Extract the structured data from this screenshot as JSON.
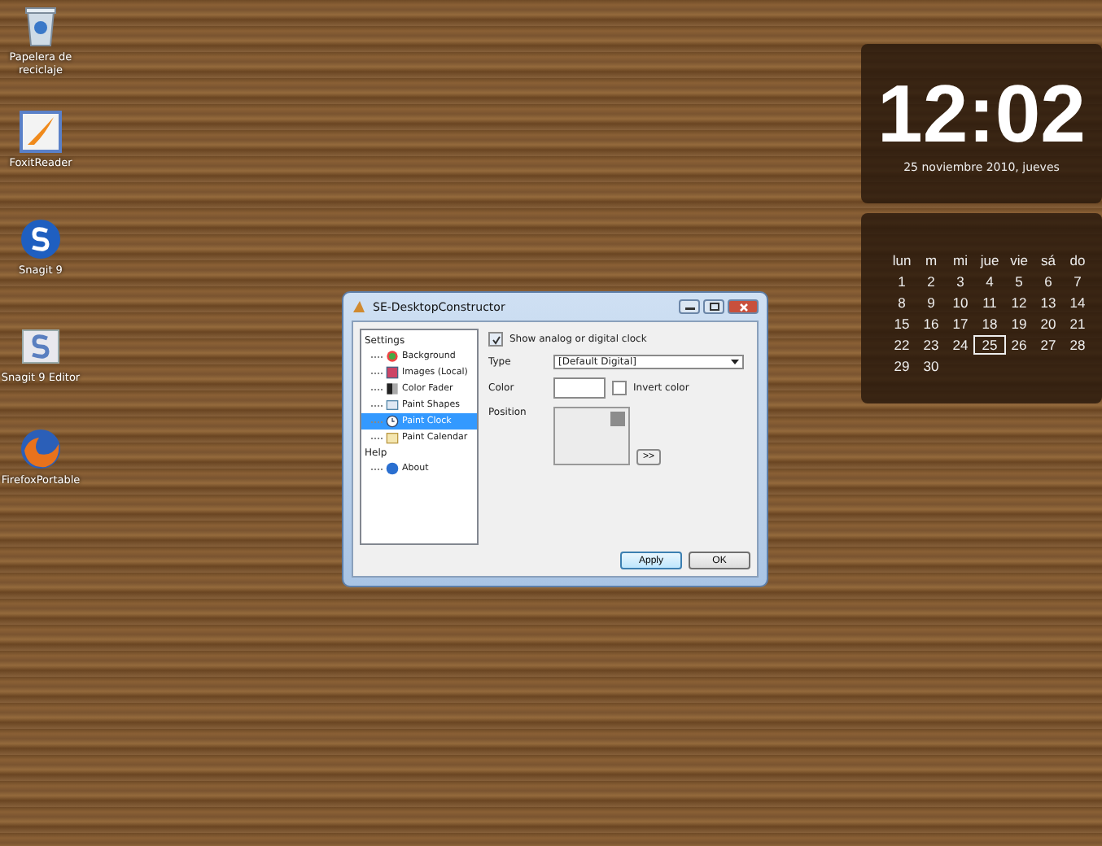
{
  "desktop_icons": [
    {
      "label": "Papelera de reciclaje",
      "kind": "bin"
    },
    {
      "label": "FoxitReader",
      "kind": "pdf"
    },
    {
      "label": "Snagit 9",
      "kind": "snagit"
    },
    {
      "label": "Snagit 9 Editor",
      "kind": "editor"
    },
    {
      "label": "FirefoxPortable",
      "kind": "browser"
    }
  ],
  "clock_widget": {
    "time": "12:02",
    "date": "25 noviembre 2010, jueves"
  },
  "calendar_widget": {
    "weekdays": [
      "lun",
      "m",
      "mi",
      "jue",
      "vie",
      "sá",
      "do"
    ],
    "weeks": [
      [
        {
          "label": "1",
          "selected": false
        },
        {
          "label": "2",
          "selected": false
        },
        {
          "label": "3",
          "selected": false
        },
        {
          "label": "4",
          "selected": false
        },
        {
          "label": "5",
          "selected": false
        },
        {
          "label": "6",
          "selected": false
        },
        {
          "label": "7",
          "selected": false
        }
      ],
      [
        {
          "label": "8",
          "selected": false
        },
        {
          "label": "9",
          "selected": false
        },
        {
          "label": "10",
          "selected": false
        },
        {
          "label": "11",
          "selected": false
        },
        {
          "label": "12",
          "selected": false
        },
        {
          "label": "13",
          "selected": false
        },
        {
          "label": "14",
          "selected": false
        }
      ],
      [
        {
          "label": "15",
          "selected": false
        },
        {
          "label": "16",
          "selected": false
        },
        {
          "label": "17",
          "selected": false
        },
        {
          "label": "18",
          "selected": false
        },
        {
          "label": "19",
          "selected": false
        },
        {
          "label": "20",
          "selected": false
        },
        {
          "label": "21",
          "selected": false
        }
      ],
      [
        {
          "label": "22",
          "selected": false
        },
        {
          "label": "23",
          "selected": false
        },
        {
          "label": "24",
          "selected": false
        },
        {
          "label": "25",
          "selected": true
        },
        {
          "label": "26",
          "selected": false
        },
        {
          "label": "27",
          "selected": false
        },
        {
          "label": "28",
          "selected": false
        }
      ],
      [
        {
          "label": "29",
          "selected": false
        },
        {
          "label": "30",
          "selected": false
        }
      ]
    ]
  },
  "window": {
    "title": "SE-DesktopConstructor",
    "tree": [
      {
        "label": "Settings",
        "children": [
          {
            "label": "Background",
            "kind": "color",
            "selected": false
          },
          {
            "label": "Images (Local)",
            "kind": "image",
            "selected": false
          },
          {
            "label": "Color Fader",
            "kind": "fader",
            "selected": false
          },
          {
            "label": "Paint Shapes",
            "kind": "shapes",
            "selected": false
          },
          {
            "label": "Paint Clock",
            "kind": "clock",
            "selected": true
          },
          {
            "label": "Paint Calendar",
            "kind": "calendar",
            "selected": false
          }
        ]
      },
      {
        "label": "Help",
        "children": [
          {
            "label": "About",
            "kind": "help",
            "selected": false
          }
        ]
      }
    ],
    "show_clock": {
      "label": "Show analog or digital clock",
      "checked": true
    },
    "type": {
      "label": "Type",
      "value": "[Default Digital]"
    },
    "color": {
      "label": "Color"
    },
    "invert_color": {
      "label": "Invert color",
      "checked": false
    },
    "position": {
      "label": "Position",
      "button": ">>"
    },
    "buttons": [
      {
        "label": "Apply",
        "default": true
      },
      {
        "label": "OK",
        "default": false
      }
    ]
  }
}
